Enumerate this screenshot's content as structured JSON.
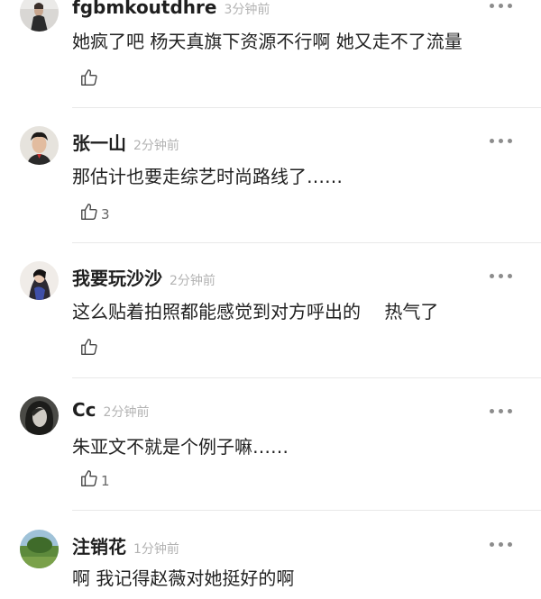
{
  "comments": [
    {
      "user": "fgbmkoutdhre",
      "time": "3分钟前",
      "text": "她疯了吧 杨天真旗下资源不行啊 她又走不了流量",
      "likes": ""
    },
    {
      "user": "张一山",
      "time": "2分钟前",
      "text": "那估计也要走综艺时尚路线了……",
      "likes": "3"
    },
    {
      "user": "我要玩沙沙",
      "time": "2分钟前",
      "text": "这么贴着拍照都能感觉到对方呼出的　  热气了",
      "likes": ""
    },
    {
      "user": "Cc",
      "time": "2分钟前",
      "text": "朱亚文不就是个例子嘛……",
      "likes": "1"
    },
    {
      "user": "注销花",
      "time": "1分钟前",
      "text": "啊 我记得赵薇对她挺好的啊",
      "likes": ""
    }
  ],
  "colors": {
    "name": "#1f1f1f",
    "time": "#b3b3b3",
    "text": "#222222",
    "divider": "#e9e9e9"
  },
  "icons": {
    "like": "thumbs-up-icon",
    "more": "more-dots-icon"
  }
}
